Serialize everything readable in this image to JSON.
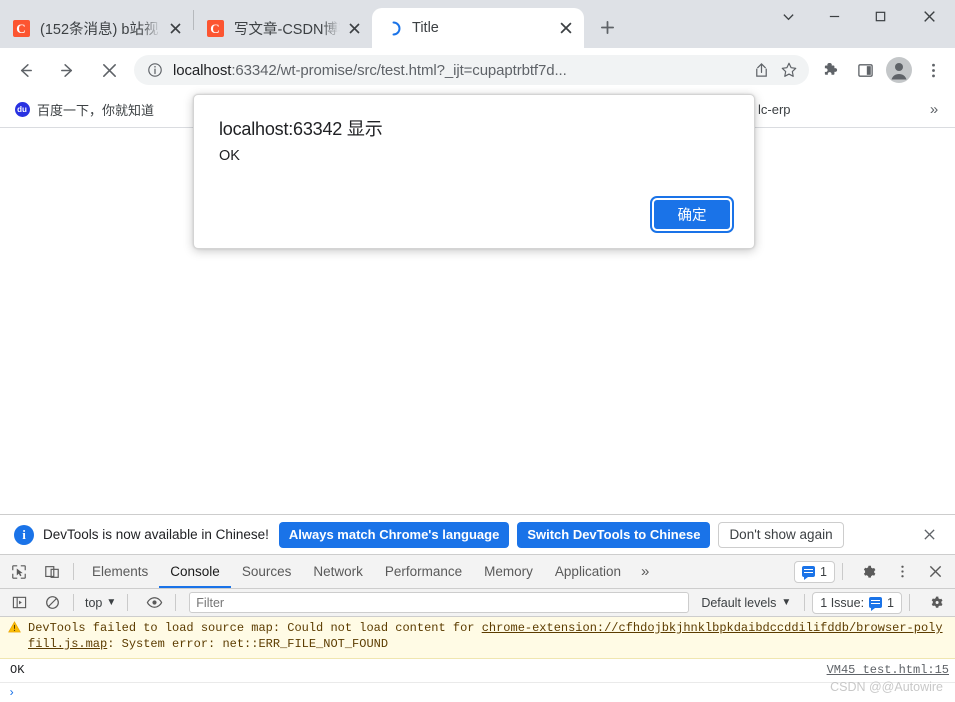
{
  "window": {
    "controls": {
      "tab_search_label": "tab-search",
      "minimize_label": "—",
      "maximize_label": "□",
      "close_label": "✕"
    }
  },
  "tabs": [
    {
      "title": "(152条消息) b站视",
      "favicon": "csdn-icon",
      "favicon_letter": "C",
      "active": false
    },
    {
      "title": "写文章-CSDN博客",
      "favicon": "csdn-icon",
      "favicon_letter": "C",
      "active": false
    },
    {
      "title": "Title",
      "favicon": "loading-spinner-icon",
      "active": true
    }
  ],
  "newtab_label": "+",
  "toolbar": {
    "back_label": "←",
    "forward_label": "→",
    "stop_label": "✕",
    "url_prefix": "localhost",
    "url_rest": ":63342/wt-promise/src/test.html?_ijt=cupaptrbtf7d...",
    "url_full": "localhost:63342/wt-promise/src/test.html?_ijt=cupaptrbtf7d...",
    "icons": {
      "site_info": "info-icon",
      "share": "share-icon",
      "bookmark": "star-icon",
      "extensions": "puzzle-icon",
      "side_panel": "side-panel-icon",
      "profile": "profile-avatar-icon",
      "menu": "three-dot-menu-icon"
    }
  },
  "bookmarks": {
    "items": [
      {
        "label": "百度一下，你就知道",
        "icon": "baidu-icon",
        "icon_letter": "du"
      },
      {
        "label": "lc-erp",
        "icon": "folder-icon"
      }
    ],
    "overflow_label": "»"
  },
  "dialog": {
    "title": "localhost:63342 显示",
    "message": "OK",
    "ok_label": "确定"
  },
  "devtools": {
    "banner": {
      "icon": "info-icon",
      "icon_letter": "i",
      "text": "DevTools is now available in Chinese!",
      "primary_button": "Always match Chrome's language",
      "secondary_button": "Switch DevTools to Chinese",
      "dismiss_button": "Don't show again",
      "close_label": "✕"
    },
    "tabs": [
      {
        "label": "Elements",
        "active": false
      },
      {
        "label": "Console",
        "active": true
      },
      {
        "label": "Sources",
        "active": false
      },
      {
        "label": "Network",
        "active": false
      },
      {
        "label": "Performance",
        "active": false
      },
      {
        "label": "Memory",
        "active": false
      },
      {
        "label": "Application",
        "active": false
      }
    ],
    "tabs_overflow_label": "»",
    "tab_icons": {
      "inspect": "inspect-element-icon",
      "device": "device-toolbar-icon"
    },
    "message_count": "1",
    "right_icons": {
      "settings": "gear-icon",
      "more": "three-dot-menu-icon",
      "close": "close-icon"
    },
    "console_toolbar": {
      "sidebar_label": "console-sidebar-icon",
      "clear_label": "clear-console-icon",
      "context": "top",
      "context_caret": "▼",
      "eye_label": "live-expression-icon",
      "filter_placeholder": "Filter",
      "levels": "Default levels",
      "levels_caret": "▼",
      "issues_label": "1 Issue:",
      "issues_count": "1",
      "settings_label": "gear-icon"
    },
    "console_messages": [
      {
        "type": "warning",
        "icon": "warning-triangle-icon",
        "text_before": "DevTools failed to load source map: Could not load content for ",
        "link": "chrome-extension://cfhdojbkjhnklbpkdaibdccddilifddb/browser-polyfill.js.map",
        "text_after": ": System error: net::ERR_FILE_NOT_FOUND"
      },
      {
        "type": "log",
        "text": "OK",
        "source": "VM45 test.html:15"
      }
    ],
    "prompt_caret": "›"
  },
  "watermark": "CSDN @@Autowire",
  "colors": {
    "accent_blue": "#1a73e8",
    "tabstrip_bg": "#dee1e6",
    "csdn_red": "#fc5531",
    "warning_bg": "#fffbe5",
    "folder_yellow": "#fdd663"
  }
}
